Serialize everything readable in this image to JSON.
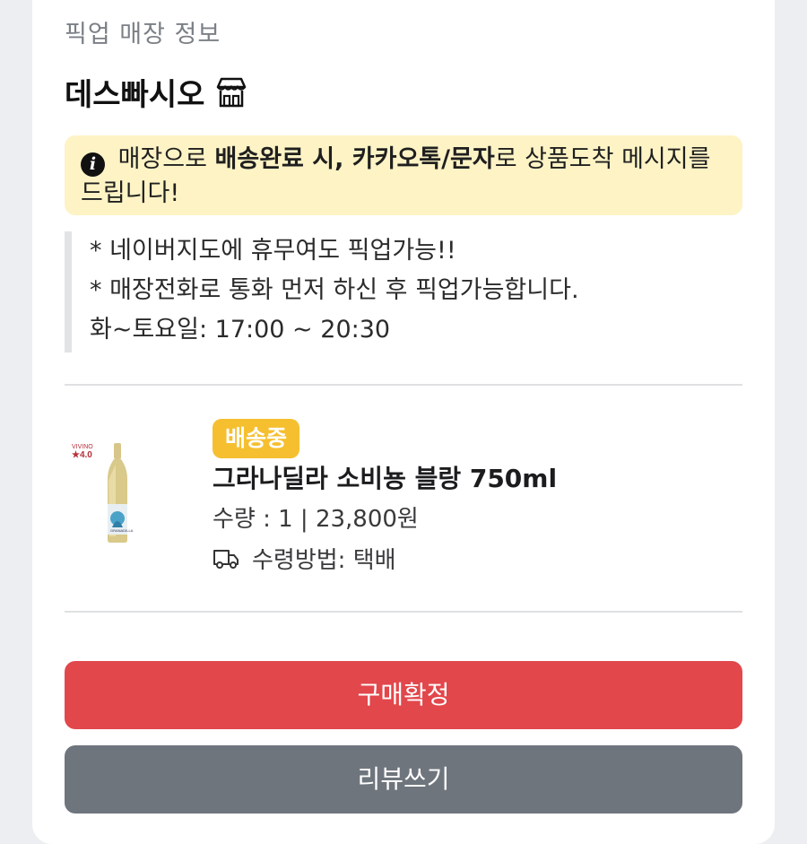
{
  "pickup": {
    "section_label": "픽업 매장 정보",
    "store_name": "데스빠시오",
    "notice": {
      "part1": " 매장으로 ",
      "bold": "배송완료 시, 카카오톡/문자",
      "part2": "로 상품도착 메시지를 드립니다!"
    },
    "memo_lines": [
      "* 네이버지도에 휴무여도 픽업가능!!",
      "* 매장전화로 통화 먼저 하신 후 픽업가능합니다.",
      "화~토요일: 17:00 ~ 20:30"
    ]
  },
  "product": {
    "status_badge": "배송중",
    "name": "그라나딜라 소비뇽 블랑 750ml",
    "quantity_price": "수량 : 1 | 23,800원",
    "delivery_method": "수령방법: 택배",
    "vivino_label": "VIVINO",
    "vivino_rating": "★4.0"
  },
  "actions": {
    "confirm_label": "구매확정",
    "review_label": "리뷰쓰기"
  },
  "colors": {
    "badge": "#f5bf2f",
    "confirm": "#e2474b",
    "review": "#6f757d",
    "notice_bg": "#fdf3c5"
  }
}
